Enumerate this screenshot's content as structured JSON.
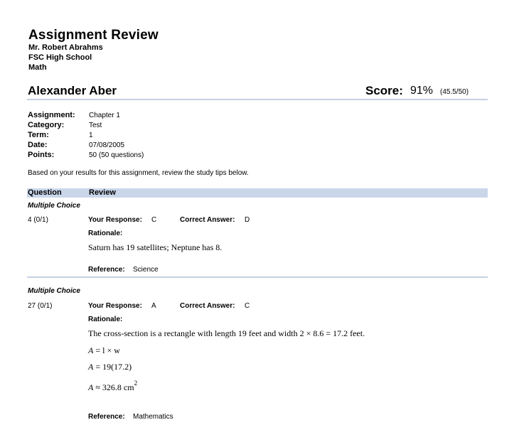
{
  "header": {
    "title": "Assignment Review",
    "teacher": "Mr. Robert Abrahms",
    "school": "FSC High School",
    "subject": "Math"
  },
  "student": {
    "name": "Alexander Aber",
    "score_label": "Score:",
    "score_percent": "91%",
    "score_detail": "(45.5/50)"
  },
  "assignment": {
    "assignment_label": "Assignment:",
    "assignment_value": "Chapter 1",
    "category_label": "Category:",
    "category_value": "Test",
    "term_label": "Term:",
    "term_value": "1",
    "date_label": "Date:",
    "date_value": "07/08/2005",
    "points_label": "Points:",
    "points_value": "50  (50 questions)"
  },
  "note": "Based on your results for this assignment, review the study tips below.",
  "table": {
    "col_question": "Question",
    "col_review": "Review"
  },
  "labels": {
    "your_response": "Your Response:",
    "correct_answer": "Correct Answer:",
    "rationale": "Rationale:",
    "reference": "Reference:"
  },
  "questions": [
    {
      "section": "Multiple Choice",
      "number": "4 (0/1)",
      "response": "C",
      "correct": "D",
      "rationale": "Saturn has 19 satellites; Neptune has 8.",
      "reference": "Science"
    },
    {
      "section": "Multiple Choice",
      "number": "27 (0/1)",
      "response": "A",
      "correct": "C",
      "rationale": "The cross-section is a rectangle with length 19 feet and width 2 × 8.6 = 17.2 feet.",
      "math1_lhs": "A",
      "math1_rhs": "= l × w",
      "math2_lhs": "A",
      "math2_rhs": "= 19(17.2)",
      "math3_lhs": "A",
      "math3_rhs": "≈ 326.8 cm",
      "math3_sup": "2",
      "reference": "Mathematics"
    }
  ]
}
